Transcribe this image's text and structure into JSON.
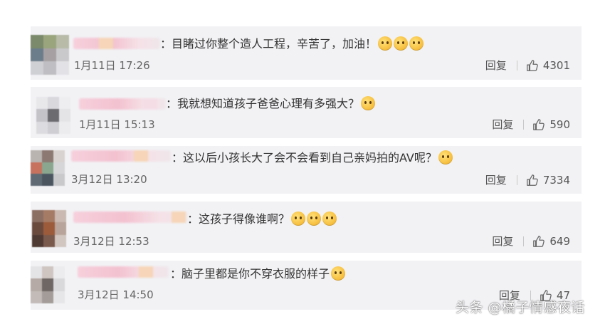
{
  "comments": [
    {
      "text": "：目睹过你整个造人工程，辛苦了，加油！",
      "emojis": 3,
      "date": "1月11日 17:26",
      "reply_label": "回复",
      "likes": "4301"
    },
    {
      "text": "：我就想知道孩子爸爸心理有多强大？",
      "emojis": 1,
      "date": "1月11日 15:13",
      "reply_label": "回复",
      "likes": "590"
    },
    {
      "text": "：这以后小孩长大了会不会看到自己亲妈拍的AV呢？",
      "emojis": 1,
      "date": "3月12日 13:20",
      "reply_label": "回复",
      "likes": "7334"
    },
    {
      "text": "：这孩子得像谁啊？",
      "emojis": 3,
      "date": "3月12日 12:53",
      "reply_label": "回复",
      "likes": "649"
    },
    {
      "text": "：脑子里都是你不穿衣服的样子",
      "emojis": 1,
      "date": "3月12日 14:50",
      "reply_label": "回复",
      "likes": "47"
    }
  ],
  "watermark": "头条 @橘子情感夜话",
  "icons": {
    "like": "thumbs-up-icon",
    "emoji": "emoji-face-icon"
  },
  "colors": {
    "card_bg": "#f2f2f5",
    "text": "#333333",
    "meta": "#666666"
  }
}
